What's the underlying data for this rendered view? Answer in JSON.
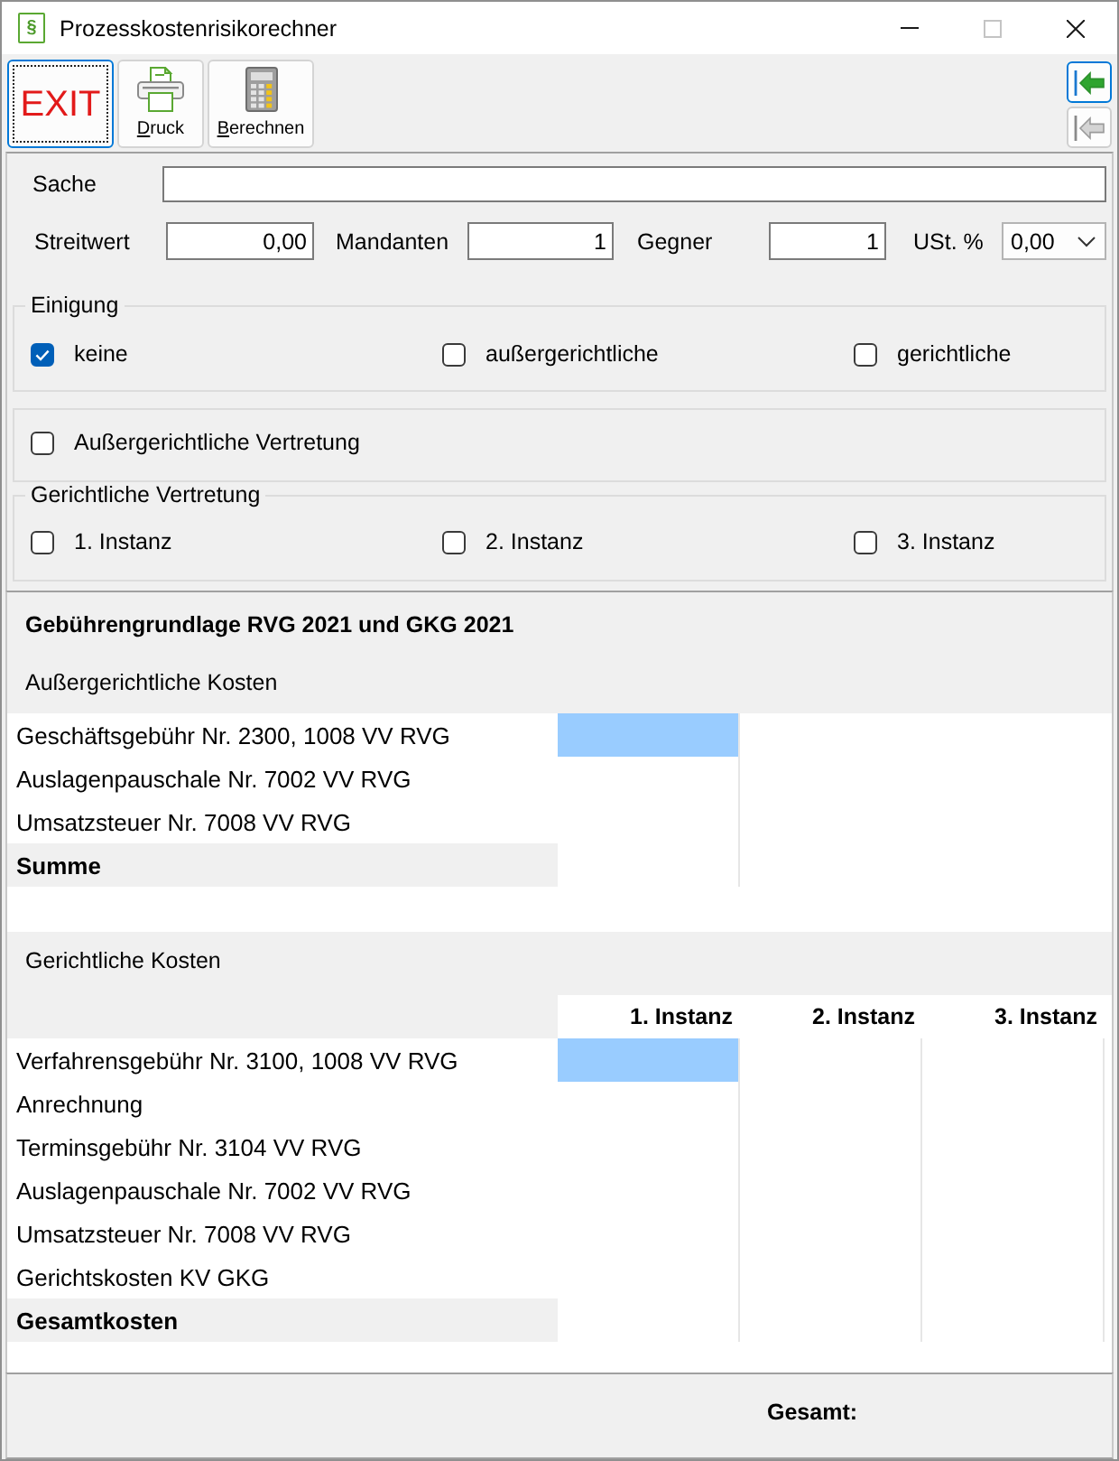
{
  "window": {
    "icon_glyph": "§",
    "title": "Prozesskostenrisikorechner",
    "controls": [
      {
        "kind": "minimize",
        "disabled": false
      },
      {
        "kind": "maximize",
        "disabled": true
      },
      {
        "kind": "close",
        "disabled": false
      }
    ]
  },
  "toolbar": {
    "buttons": [
      {
        "kind": "exit",
        "label": "EXIT",
        "focused": true
      },
      {
        "kind": "print",
        "label": "Druck",
        "focused": false
      },
      {
        "kind": "calculate",
        "label": "Berechnen",
        "focused": false
      }
    ],
    "side_buttons": [
      {
        "disabled": false
      },
      {
        "disabled": true
      }
    ]
  },
  "form": {
    "case": {
      "label": "Sache"
    },
    "fields": [
      {
        "kind": "input",
        "label": "Streitwert",
        "value": "0,00"
      },
      {
        "kind": "input",
        "label": "Mandanten",
        "value": "1"
      },
      {
        "kind": "input",
        "label": "Gegner",
        "value": "1"
      },
      {
        "kind": "select",
        "label": "USt. %",
        "value": "0,00"
      }
    ],
    "settlement": {
      "legend": "Einigung",
      "options": [
        {
          "label": "keine",
          "checked": true
        },
        {
          "label": "außergerichtliche",
          "checked": false
        },
        {
          "label": "gerichtliche",
          "checked": false
        }
      ]
    },
    "out_of_court": {
      "options": [
        {
          "label": "Außergerichtliche Vertretung",
          "checked": false
        }
      ]
    },
    "court": {
      "legend": "Gerichtliche Vertretung",
      "options": [
        {
          "label": "1. Instanz",
          "checked": false
        },
        {
          "label": "2. Instanz",
          "checked": false
        },
        {
          "label": "3. Instanz",
          "checked": false
        }
      ]
    }
  },
  "results": {
    "title": "Gebührengrundlage RVG 2021 und GKG 2021",
    "out_of_court_costs": {
      "heading": "Außergerichtliche Kosten",
      "rows": [
        {
          "kind": "item",
          "label": "Geschäftsgebühr Nr. 2300, 1008 VV RVG",
          "selected": true
        },
        {
          "kind": "item",
          "label": "Auslagenpauschale Nr. 7002 VV RVG",
          "selected": false
        },
        {
          "kind": "item",
          "label": "Umsatzsteuer Nr. 7008 VV RVG",
          "selected": false
        },
        {
          "kind": "total",
          "label": "Summe",
          "selected": false
        }
      ]
    },
    "court_costs": {
      "heading": "Gerichtliche Kosten",
      "columns": [
        "1. Instanz",
        "2. Instanz",
        "3. Instanz"
      ],
      "rows": [
        {
          "kind": "item",
          "label": "Verfahrensgebühr Nr. 3100, 1008 VV RVG",
          "selected": true
        },
        {
          "kind": "item",
          "label": "Anrechnung",
          "selected": false
        },
        {
          "kind": "item",
          "label": "Terminsgebühr Nr. 3104 VV RVG",
          "selected": false
        },
        {
          "kind": "item",
          "label": "Auslagenpauschale Nr. 7002 VV RVG",
          "selected": false
        },
        {
          "kind": "item",
          "label": "Umsatzsteuer Nr. 7008 VV RVG",
          "selected": false
        },
        {
          "kind": "item",
          "label": "Gerichtskosten KV GKG",
          "selected": false
        },
        {
          "kind": "total",
          "label": "Gesamtkosten",
          "selected": false
        }
      ]
    }
  },
  "footer": {
    "label": "Gesamt:"
  }
}
